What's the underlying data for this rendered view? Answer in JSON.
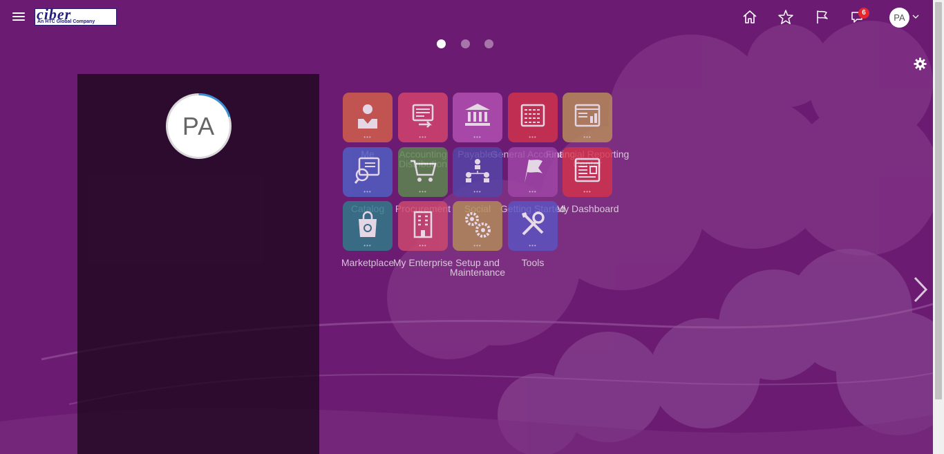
{
  "header": {
    "logo_word": "ciber",
    "logo_tagline": "An HTC Global Company",
    "notification_count": "6",
    "user_initials": "PA"
  },
  "pager": {
    "pages": 3,
    "active": 1
  },
  "panel": {
    "avatar_initials": "PA"
  },
  "apps": [
    {
      "label": "Me",
      "color": "#d4604a",
      "icon": "person-icon"
    },
    {
      "label": "Accounting Distribution",
      "color": "#d6456d",
      "icon": "distribution-icon"
    },
    {
      "label": "Payables",
      "color": "#b552b4",
      "icon": "bank-icon"
    },
    {
      "label": "General Accounting",
      "color": "#d3344b",
      "icon": "ledger-icon"
    },
    {
      "label": "Financial Reporting Center",
      "color": "#b98e5a",
      "icon": "report-icon"
    },
    {
      "label": "Catalog",
      "color": "#4f61c6",
      "icon": "catalog-search-icon"
    },
    {
      "label": "Procurement",
      "color": "#5d8a4f",
      "icon": "cart-icon"
    },
    {
      "label": "Social",
      "color": "#5546a8",
      "icon": "social-network-icon"
    },
    {
      "label": "Getting Started",
      "color": "#a047a8",
      "icon": "flag-icon"
    },
    {
      "label": "My Dashboard",
      "color": "#d3344b",
      "icon": "dashboard-icon"
    },
    {
      "label": "Marketplace",
      "color": "#2f7d8a",
      "icon": "shopping-bag-icon"
    },
    {
      "label": "My Enterprise",
      "color": "#cf4a6e",
      "icon": "building-icon"
    },
    {
      "label": "Setup and Maintenance",
      "color": "#b38e58",
      "icon": "gears-icon"
    },
    {
      "label": "Tools",
      "color": "#5c55c2",
      "icon": "tools-icon"
    }
  ]
}
